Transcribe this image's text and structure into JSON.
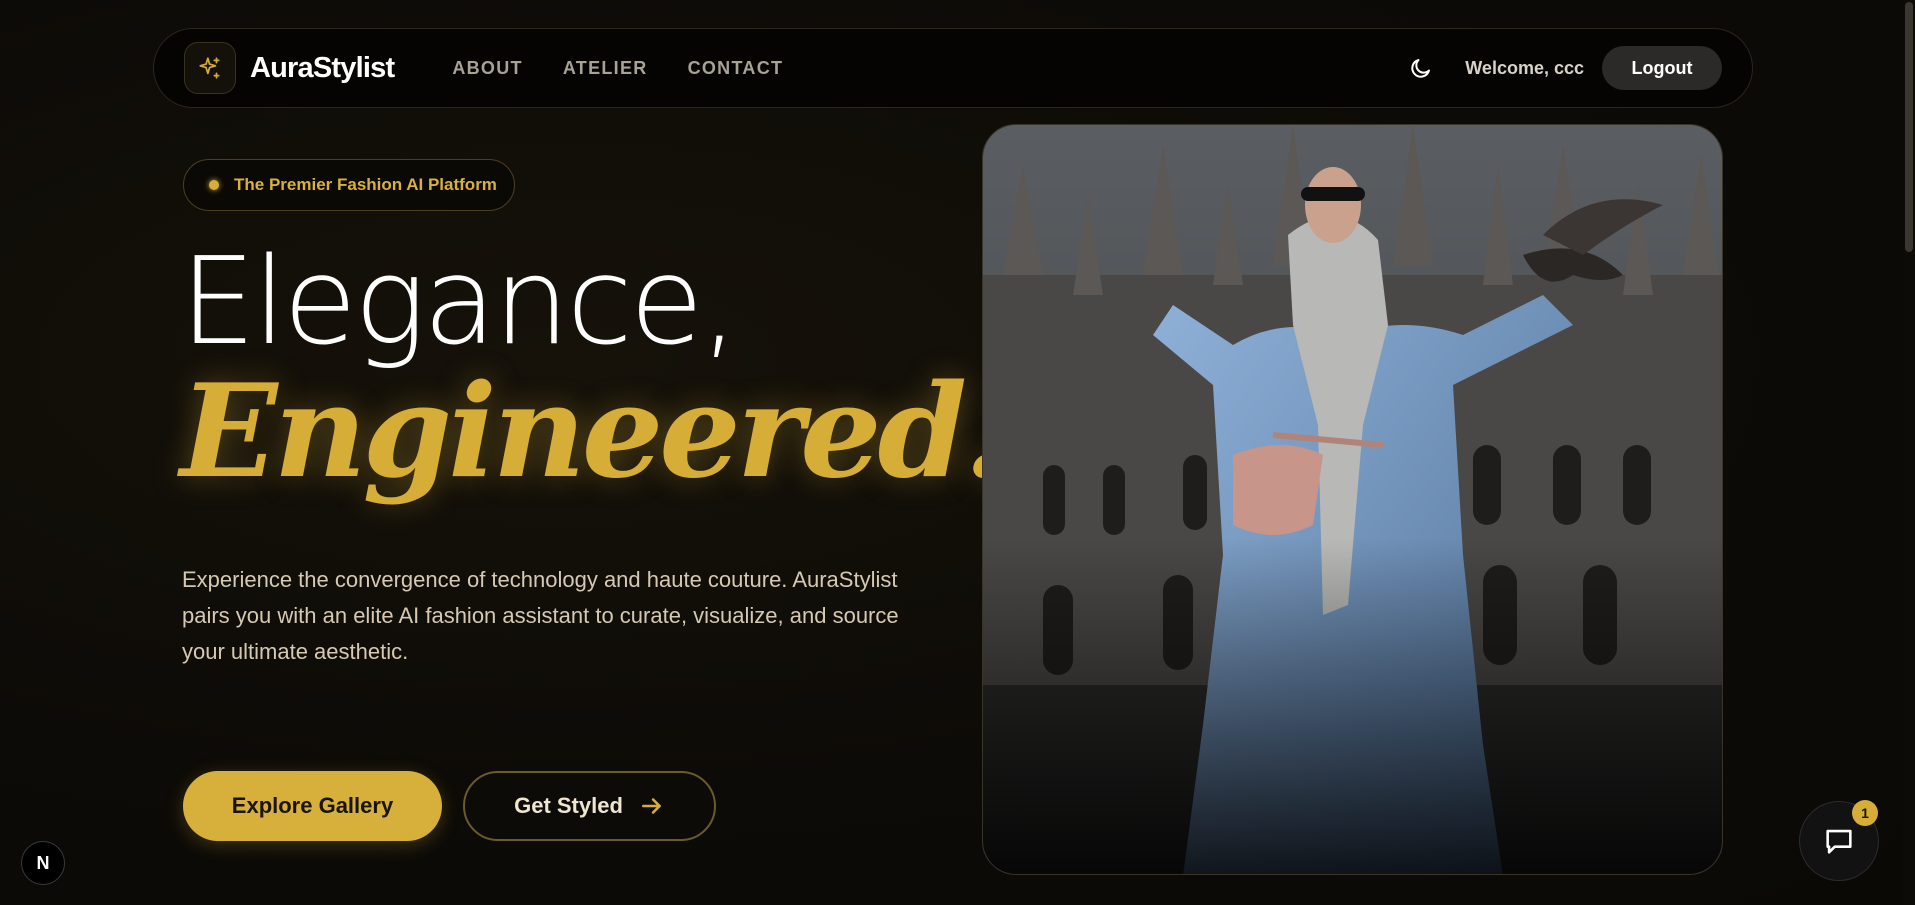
{
  "nav": {
    "brand": "AuraStylist",
    "links": [
      "ABOUT",
      "ATELIER",
      "CONTACT"
    ],
    "welcome": "Welcome, ccc",
    "logout": "Logout",
    "icons": {
      "logo": "sparkles-icon",
      "theme": "moon-icon"
    }
  },
  "hero": {
    "badge": "The Premier Fashion AI Platform",
    "headline_line1": "Elegance,",
    "headline_line2": "Engineered.",
    "description": "Experience the convergence of technology and haute couture. AuraStylist pairs you with an elite AI fashion assistant to curate, visualize, and source your ultimate aesthetic.",
    "primary_cta": "Explore Gallery",
    "secondary_cta": "Get Styled"
  },
  "dev_badge": "N",
  "chat": {
    "unread_count": "1",
    "icon": "chat-icon"
  },
  "colors": {
    "accent": "#d6ad36",
    "background": "#0d0b06",
    "nav_bg": "#050403"
  }
}
